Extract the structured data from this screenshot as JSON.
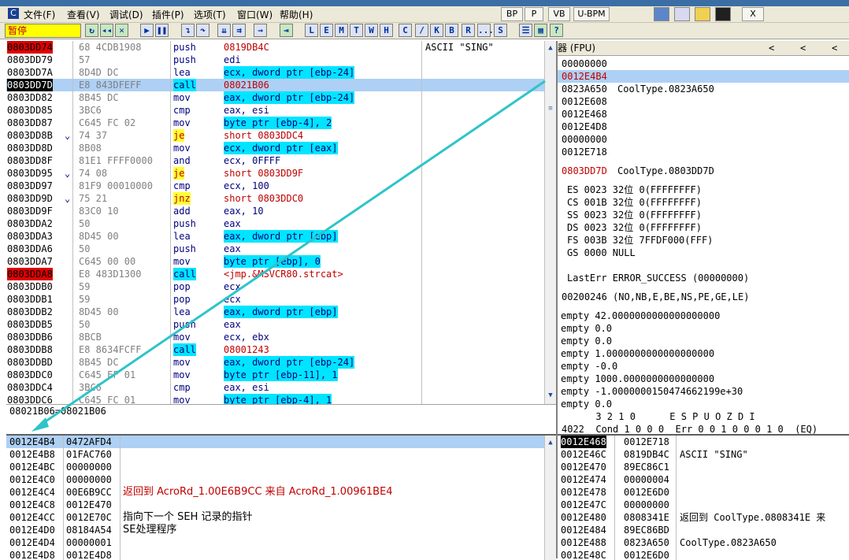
{
  "menubar": {
    "app_icon": "C",
    "items": [
      "文件(F)",
      "查看(V)",
      "调试(D)",
      "插件(P)",
      "选项(T)",
      "窗口(W)",
      "帮助(H)"
    ],
    "buttons": [
      "BP",
      "P",
      "VB",
      "U-BPM"
    ],
    "close_glyph": "X"
  },
  "toolbar": {
    "status": "暂停",
    "letters": [
      "L",
      "E",
      "M",
      "T",
      "W",
      "H",
      "C",
      "/",
      "K",
      "B",
      "R",
      "...",
      "S"
    ]
  },
  "disasm": {
    "rows": [
      {
        "addr": "0803DD74",
        "hex": "68 4CDB1908",
        "mn": "push",
        "op": "0819DB4C",
        "cmt": "ASCII \"SING\"",
        "addr_style": "red"
      },
      {
        "addr": "0803DD79",
        "hex": "57",
        "mn": "push",
        "op": "edi",
        "cmt": ""
      },
      {
        "addr": "0803DD7A",
        "hex": "8D4D DC",
        "mn": "lea",
        "op": "ecx, dword ptr [ebp-24]",
        "cmt": ""
      },
      {
        "addr": "0803DD7D",
        "hex": "E8 843DFEFF",
        "mn": "call",
        "op": "08021B06",
        "cmt": "",
        "addr_style": "black",
        "row_hl": true
      },
      {
        "addr": "0803DD82",
        "hex": "8B45 DC",
        "mn": "mov",
        "op": "eax, dword ptr [ebp-24]",
        "cmt": ""
      },
      {
        "addr": "0803DD85",
        "hex": "3BC6",
        "mn": "cmp",
        "op": "eax, esi",
        "cmt": ""
      },
      {
        "addr": "0803DD87",
        "hex": "C645 FC 02",
        "mn": "mov",
        "op": "byte ptr [ebp-4], 2",
        "cmt": ""
      },
      {
        "addr": "0803DD8B",
        "hex": "74 37",
        "mn": "je",
        "op": "short 0803DDC4",
        "cmt": "",
        "jmark": "⌄"
      },
      {
        "addr": "0803DD8D",
        "hex": "8B08",
        "mn": "mov",
        "op": "ecx, dword ptr [eax]",
        "cmt": ""
      },
      {
        "addr": "0803DD8F",
        "hex": "81E1 FFFF0000",
        "mn": "and",
        "op": "ecx, 0FFFF",
        "cmt": ""
      },
      {
        "addr": "0803DD95",
        "hex": "74 08",
        "mn": "je",
        "op": "short 0803DD9F",
        "cmt": "",
        "jmark": "⌄"
      },
      {
        "addr": "0803DD97",
        "hex": "81F9 00010000",
        "mn": "cmp",
        "op": "ecx, 100",
        "cmt": ""
      },
      {
        "addr": "0803DD9D",
        "hex": "75 21",
        "mn": "jnz",
        "op": "short 0803DDC0",
        "cmt": "",
        "jmark": "⌄"
      },
      {
        "addr": "0803DD9F",
        "hex": "83C0 10",
        "mn": "add",
        "op": "eax, 10",
        "cmt": ""
      },
      {
        "addr": "0803DDA2",
        "hex": "50",
        "mn": "push",
        "op": "eax",
        "cmt": ""
      },
      {
        "addr": "0803DDA3",
        "hex": "8D45 00",
        "mn": "lea",
        "op": "eax, dword ptr [ebp]",
        "cmt": ""
      },
      {
        "addr": "0803DDA6",
        "hex": "50",
        "mn": "push",
        "op": "eax",
        "cmt": ""
      },
      {
        "addr": "0803DDA7",
        "hex": "C645 00 00",
        "mn": "mov",
        "op": "byte ptr [ebp], 0",
        "cmt": ""
      },
      {
        "addr": "0803DDA8",
        "hex": "E8 483D1300",
        "mn": "call",
        "op": "<jmp.&MSVCR80.strcat>",
        "cmt": "",
        "addr_style": "red"
      },
      {
        "addr": "0803DDB0",
        "hex": "59",
        "mn": "pop",
        "op": "ecx",
        "cmt": ""
      },
      {
        "addr": "0803DDB1",
        "hex": "59",
        "mn": "pop",
        "op": "ecx",
        "cmt": ""
      },
      {
        "addr": "0803DDB2",
        "hex": "8D45 00",
        "mn": "lea",
        "op": "eax, dword ptr [ebp]",
        "cmt": ""
      },
      {
        "addr": "0803DDB5",
        "hex": "50",
        "mn": "push",
        "op": "eax",
        "cmt": ""
      },
      {
        "addr": "0803DDB6",
        "hex": "8BCB",
        "mn": "mov",
        "op": "ecx, ebx",
        "cmt": ""
      },
      {
        "addr": "0803DDB8",
        "hex": "E8 8634FCFF",
        "mn": "call",
        "op": "08001243",
        "cmt": ""
      },
      {
        "addr": "0803DDBD",
        "hex": "8B45 DC",
        "mn": "mov",
        "op": "eax, dword ptr [ebp-24]",
        "cmt": ""
      },
      {
        "addr": "0803DDC0",
        "hex": "C645 EF 01",
        "mn": "mov",
        "op": "byte ptr [ebp-11], 1",
        "cmt": ""
      },
      {
        "addr": "0803DDC4",
        "hex": "3BC6",
        "mn": "cmp",
        "op": "eax, esi",
        "cmt": ""
      },
      {
        "addr": "0803DDC6",
        "hex": "C645 FC 01",
        "mn": "mov",
        "op": "byte ptr [ebp-4], 1",
        "cmt": ""
      }
    ],
    "info_line": "08021B06=08021B06"
  },
  "registers": {
    "header_title": "器 (FPU)",
    "header_arrows": [
      "<",
      "<",
      "<"
    ],
    "top": [
      {
        "val": "00000000",
        "cmt": ""
      },
      {
        "val": "0012E4B4",
        "cmt": "",
        "red": true,
        "hl": true
      },
      {
        "val": "0823A650",
        "cmt": "CoolType.0823A650"
      },
      {
        "val": "0012E608",
        "cmt": ""
      },
      {
        "val": "0012E468",
        "cmt": ""
      },
      {
        "val": "0012E4D8",
        "cmt": ""
      },
      {
        "val": "00000000",
        "cmt": ""
      },
      {
        "val": "0012E718",
        "cmt": ""
      }
    ],
    "eip": {
      "val": "0803DD7D",
      "cmt": "CoolType.0803DD7D"
    },
    "segs": [
      "ES 0023 32位 0(FFFFFFFF)",
      "CS 001B 32位 0(FFFFFFFF)",
      "SS 0023 32位 0(FFFFFFFF)",
      "DS 0023 32位 0(FFFFFFFF)",
      "FS 003B 32位 7FFDF000(FFF)",
      "GS 0000 NULL"
    ],
    "lasterr": "LastErr ERROR_SUCCESS (00000000)",
    "eflags": "00200246 (NO,NB,E,BE,NS,PE,GE,LE)",
    "fpu": [
      "empty 42.0000000000000000000",
      "empty 0.0",
      "empty 0.0",
      "empty 1.0000000000000000000",
      "empty -0.0",
      "empty 1000.0000000000000000",
      "empty -1.0000000150474662199e+30",
      "empty 0.0"
    ],
    "bits_header": "      3 2 1 0      E S P U O Z D I",
    "bits_line": "4022  Cond 1 0 0 0  Err 0 0 1 0 0 0 1 0  (EQ)"
  },
  "dump": {
    "rows": [
      {
        "addr": "0012E4B4",
        "val": "0472AFD4",
        "cmt": "",
        "hl": true,
        "addr_style": "blue"
      },
      {
        "addr": "0012E4B8",
        "val": "01FAC760",
        "cmt": ""
      },
      {
        "addr": "0012E4BC",
        "val": "00000000",
        "cmt": ""
      },
      {
        "addr": "0012E4C0",
        "val": "00000000",
        "cmt": ""
      },
      {
        "addr": "0012E4C4",
        "val": "00E6B9CC",
        "cmt": "返回到 AcroRd_1.00E6B9CC 来自 AcroRd_1.00961BE4",
        "red": true
      },
      {
        "addr": "0012E4C8",
        "val": "0012E470",
        "cmt": ""
      },
      {
        "addr": "0012E4CC",
        "val": "0012E70C",
        "cmt": "指向下一个 SEH 记录的指针"
      },
      {
        "addr": "0012E4D0",
        "val": "08184A54",
        "cmt": "SE处理程序"
      },
      {
        "addr": "0012E4D4",
        "val": "00000001",
        "cmt": ""
      },
      {
        "addr": "0012E4D8",
        "val": "0012E4D8",
        "cmt": ""
      }
    ]
  },
  "stack": {
    "rows": [
      {
        "addr": "0012E468",
        "val": "0012E718",
        "cmt": "",
        "addr_style": "black"
      },
      {
        "addr": "0012E46C",
        "val": "0819DB4C",
        "cmt": "ASCII \"SING\""
      },
      {
        "addr": "0012E470",
        "val": "89EC86C1",
        "cmt": ""
      },
      {
        "addr": "0012E474",
        "val": "00000004",
        "cmt": ""
      },
      {
        "addr": "0012E478",
        "val": "0012E6D0",
        "cmt": ""
      },
      {
        "addr": "0012E47C",
        "val": "00000000",
        "cmt": ""
      },
      {
        "addr": "0012E480",
        "val": "0808341E",
        "cmt": "返回到 CoolType.0808341E 来"
      },
      {
        "addr": "0012E484",
        "val": "89EC86BD",
        "cmt": ""
      },
      {
        "addr": "0012E488",
        "val": "0823A650",
        "cmt": "CoolType.0823A650"
      },
      {
        "addr": "0012E48C",
        "val": "0012E6D0",
        "cmt": ""
      }
    ]
  },
  "colors": {
    "accent": "#00e5ff",
    "breakpoint": "#e00000",
    "selection": "#aed0f5",
    "arrow": "#2ec4c8"
  }
}
